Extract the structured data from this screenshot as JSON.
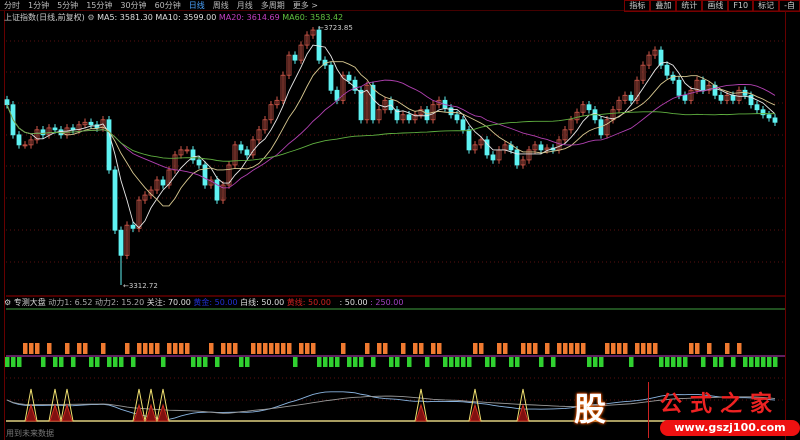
{
  "toolbar": {
    "periods": [
      "分时",
      "1分钟",
      "5分钟",
      "15分钟",
      "30分钟",
      "60分钟",
      "日线",
      "周线",
      "月线",
      "多周期",
      "更多 >"
    ],
    "active": "日线",
    "tools": [
      "指标",
      "叠加",
      "统计",
      "画线",
      "F10",
      "标记",
      "-自"
    ]
  },
  "main": {
    "title": "上证指数(日线,前复权)",
    "ma5": "MA5: 3581.30",
    "ma10": "MA10: 3599.00",
    "ma20": "MA20: 3614.69",
    "ma60": "MA60: 3583.42",
    "high_label": "3723.85",
    "low_label": "3312.72"
  },
  "sub": {
    "title": "专测大盘",
    "d1": "动力1: 6.52",
    "d2": "动力2: 15.20",
    "gz": "关注: 70.00",
    "hj": "黄金: 50.00",
    "bx": "白线: 50.00",
    "hx": "黄线: 50.00",
    "v1": ": 50.00",
    "v2": ": 250.00"
  },
  "footer": "用到未来数据",
  "logo": {
    "char": "股",
    "name": "公式之家",
    "url": "www.gszj100.com"
  },
  "colors": {
    "up": "#d0584a",
    "down": "#5ff2f2",
    "ma5": "#e8e8e8",
    "ma10": "#d8c890",
    "ma20": "#b040b0",
    "ma60": "#60b040",
    "orange": "#f07a30",
    "green": "#30d030"
  },
  "chart_data": {
    "type": "candlestick",
    "high": 3723.85,
    "low": 3312.72,
    "closes": [
      3600,
      3552,
      3536,
      3536,
      3544,
      3560,
      3552,
      3563,
      3560,
      3552,
      3563,
      3560,
      3568,
      3572,
      3568,
      3563,
      3576,
      3496,
      3400,
      3360,
      3408,
      3403,
      3448,
      3456,
      3464,
      3480,
      3472,
      3496,
      3520,
      3528,
      3528,
      3512,
      3504,
      3472,
      3480,
      3448,
      3472,
      3504,
      3536,
      3528,
      3520,
      3544,
      3560,
      3576,
      3600,
      3607,
      3647,
      3679,
      3671,
      3695,
      3711,
      3719,
      3671,
      3663,
      3623,
      3607,
      3647,
      3639,
      3623,
      3576,
      3631,
      3576,
      3592,
      3607,
      3592,
      3576,
      3584,
      3576,
      3584,
      3592,
      3576,
      3600,
      3607,
      3595,
      3584,
      3576,
      3560,
      3528,
      3536,
      3544,
      3520,
      3512,
      3528,
      3536,
      3528,
      3504,
      3512,
      3528,
      3536,
      3528,
      3531,
      3528,
      3544,
      3560,
      3576,
      3588,
      3600,
      3592,
      3576,
      3552,
      3576,
      3592,
      3607,
      3615,
      3607,
      3639,
      3663,
      3679,
      3687,
      3663,
      3647,
      3639,
      3615,
      3607,
      3623,
      3639,
      3623,
      3631,
      3615,
      3607,
      3615,
      3607,
      3623,
      3615,
      3600,
      3592,
      3584,
      3579,
      3572
    ],
    "signal_peaks": [
      4,
      8,
      10,
      22,
      24,
      26,
      69,
      78,
      86
    ]
  }
}
